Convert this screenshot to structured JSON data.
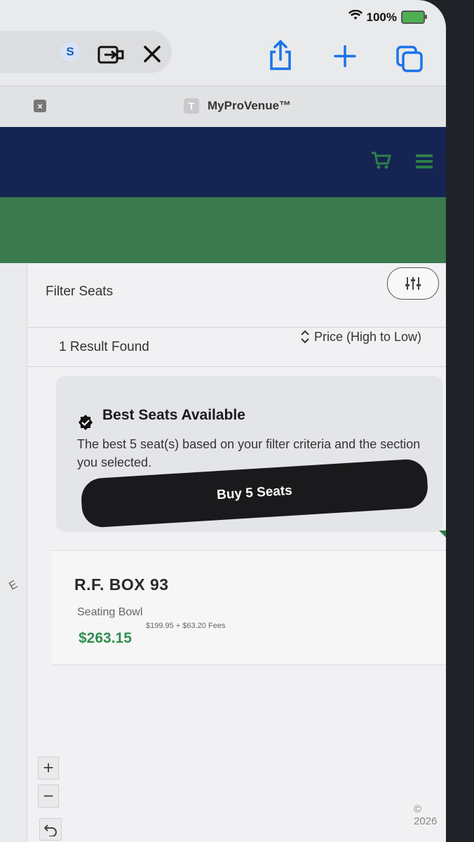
{
  "status_bar": {
    "battery": "100%"
  },
  "browser": {
    "profile_initial": "S",
    "tab_close_glyph": "×",
    "tab_favicon_letter": "T",
    "tab_title": "MyProVenue™"
  },
  "filter": {
    "label": "Filter Seats"
  },
  "results": {
    "count_label": "1 Result Found",
    "sort_label": "Price (High to Low)"
  },
  "best_seats": {
    "title": "Best Seats Available",
    "description": "The best 5 seat(s) based on your filter criteria and the section you selected.",
    "button_label": "Buy 5 Seats"
  },
  "seat_listing": {
    "name": "R.F. BOX 93",
    "area": "Seating Bowl",
    "price": "$263.15",
    "fees": "$199.95 + $63.20 Fees"
  },
  "map_controls": {
    "zoom_in": "+",
    "zoom_out": "−",
    "map_marker": "E"
  },
  "footer": {
    "copyright": "© 2026"
  },
  "colors": {
    "nav_bg": "#152452",
    "accent_green": "#3a7a4d",
    "price_green": "#2f8f4f",
    "button_dark": "#1a1a1c",
    "safari_blue": "#1a73e8"
  }
}
